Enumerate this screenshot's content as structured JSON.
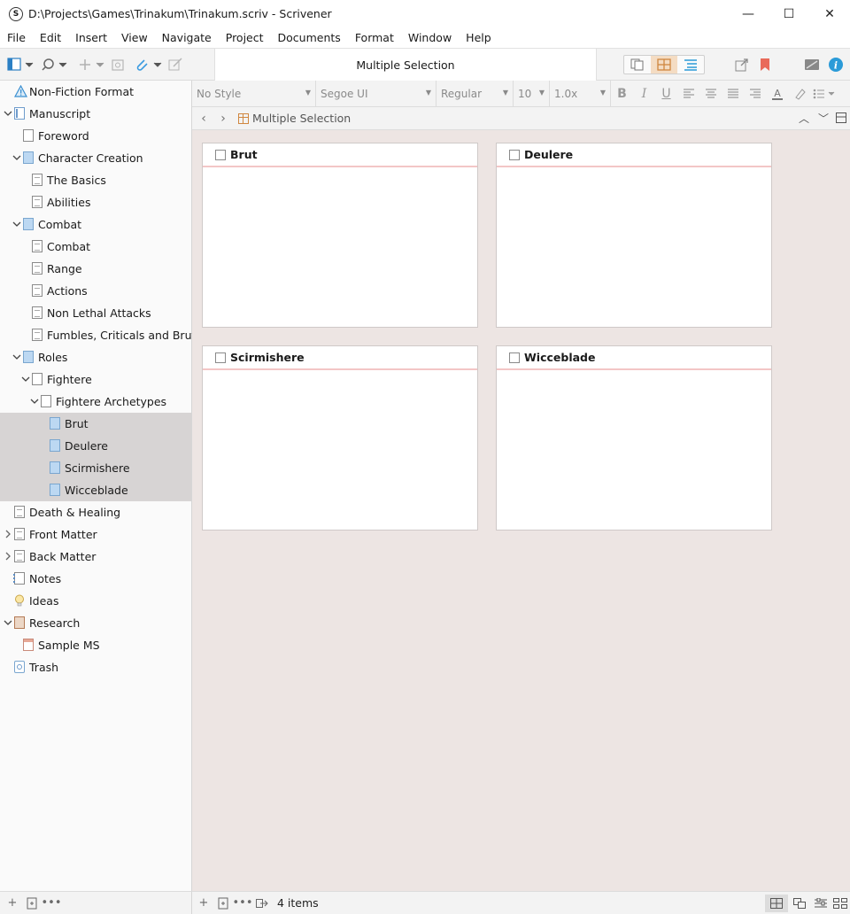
{
  "window": {
    "title": "D:\\Projects\\Games\\Trinakum\\Trinakum.scriv - Scrivener",
    "app_icon_letter": "S",
    "controls": {
      "minimize": "—",
      "maximize": "☐",
      "close": "✕"
    }
  },
  "menu": [
    "File",
    "Edit",
    "Insert",
    "View",
    "Navigate",
    "Project",
    "Documents",
    "Format",
    "Window",
    "Help"
  ],
  "toolbar": {
    "center_title": "Multiple Selection",
    "info_icon_color": "#2b9bd8",
    "bookmark_color": "#e96a5a"
  },
  "binder": {
    "items": [
      {
        "label": "Non-Fiction Format",
        "icon": "warning-icon"
      },
      {
        "label": "Manuscript",
        "icon": "manuscript-icon",
        "expanded": true
      },
      {
        "label": "Foreword",
        "icon": "page-icon"
      },
      {
        "label": "Character Creation",
        "icon": "folder-icon",
        "expanded": true
      },
      {
        "label": "The Basics",
        "icon": "document-icon"
      },
      {
        "label": "Abilities",
        "icon": "document-icon"
      },
      {
        "label": "Combat",
        "icon": "folder-icon",
        "expanded": true
      },
      {
        "label": "Combat",
        "icon": "document-icon"
      },
      {
        "label": "Range",
        "icon": "document-icon"
      },
      {
        "label": "Actions",
        "icon": "document-icon"
      },
      {
        "label": "Non Lethal Attacks",
        "icon": "document-icon"
      },
      {
        "label": "Fumbles, Criticals and Brutals",
        "icon": "document-icon"
      },
      {
        "label": "Roles",
        "icon": "folder-icon",
        "expanded": true
      },
      {
        "label": "Fightere",
        "icon": "page-icon",
        "expanded": true
      },
      {
        "label": "Fightere Archetypes",
        "icon": "page-icon",
        "expanded": true
      },
      {
        "label": "Brut",
        "icon": "folder-icon",
        "selected": true
      },
      {
        "label": "Deulere",
        "icon": "folder-icon",
        "selected": true
      },
      {
        "label": "Scirmishere",
        "icon": "folder-icon",
        "selected": true
      },
      {
        "label": "Wicceblade",
        "icon": "folder-icon",
        "selected": true
      },
      {
        "label": "Death & Healing",
        "icon": "document-icon"
      },
      {
        "label": "Front Matter",
        "icon": "front-matter-icon",
        "expanded": false
      },
      {
        "label": "Back Matter",
        "icon": "back-matter-icon",
        "expanded": false
      },
      {
        "label": "Notes",
        "icon": "notebook-icon"
      },
      {
        "label": "Ideas",
        "icon": "lightbulb-icon"
      },
      {
        "label": "Research",
        "icon": "research-icon",
        "expanded": true
      },
      {
        "label": "Sample MS",
        "icon": "sample-icon"
      },
      {
        "label": "Trash",
        "icon": "trash-icon"
      }
    ]
  },
  "format_bar": {
    "style": "No Style",
    "font": "Segoe UI",
    "weight": "Regular",
    "size": "10",
    "spacing": "1.0x"
  },
  "nav": {
    "title": "Multiple Selection"
  },
  "cards": [
    {
      "title": "Brut"
    },
    {
      "title": "Deulere"
    },
    {
      "title": "Scirmishere"
    },
    {
      "title": "Wicceblade"
    }
  ],
  "footer": {
    "count": "4 items"
  }
}
